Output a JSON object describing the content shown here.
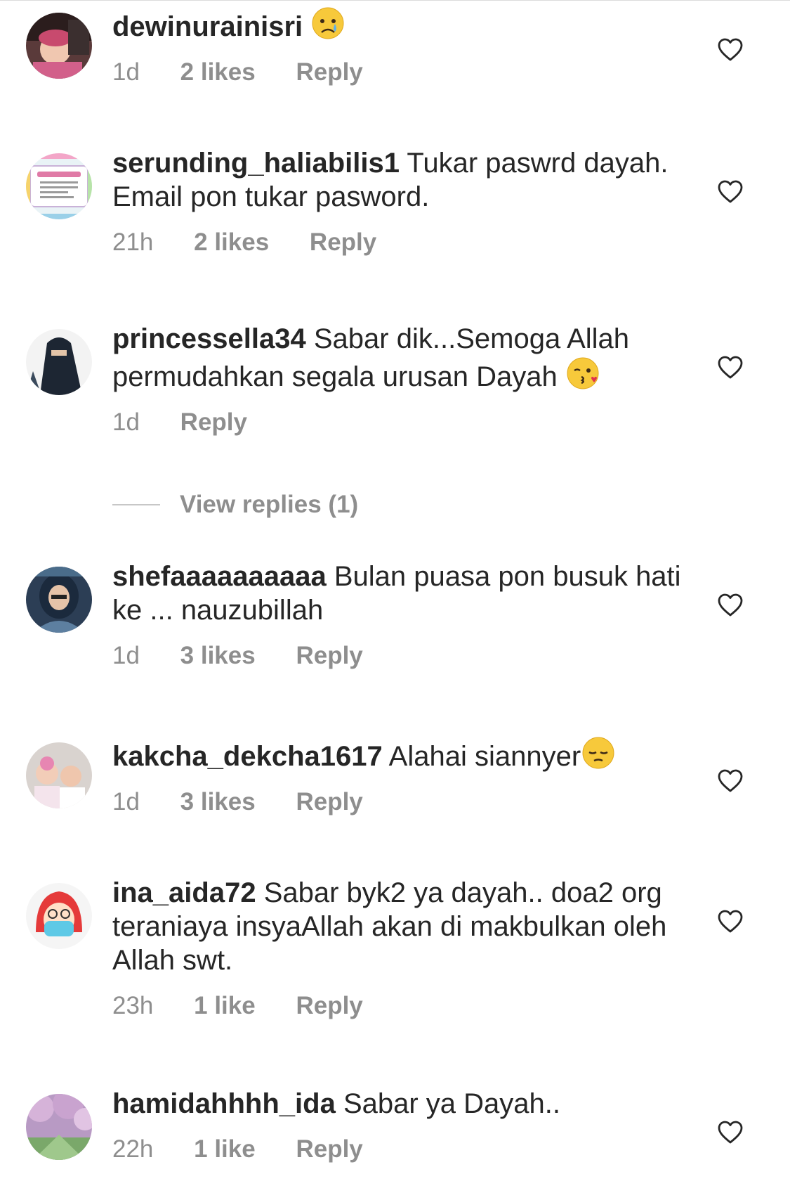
{
  "comments": [
    {
      "username": "dewinurainisri",
      "text": "",
      "emoji": "crying-face",
      "time": "1d",
      "likes": "2 likes",
      "reply": "Reply",
      "avatar": "baby-photo"
    },
    {
      "username": "serunding_haliabilis1",
      "text": "Tukar paswrd dayah. Email pon tukar pasword.",
      "emoji": "",
      "time": "21h",
      "likes": "2 likes",
      "reply": "Reply",
      "avatar": "shop-label-photo"
    },
    {
      "username": "princessella34",
      "text": "Sabar dik...Semoga Allah permudahkan segala urusan Dayah",
      "emoji": "face-blowing-kiss",
      "time": "1d",
      "likes": "",
      "reply": "Reply",
      "avatar": "niqab-photo"
    },
    {
      "username": "shefaaaaaaaaaa",
      "text": "Bulan puasa pon busuk hati ke ... nauzubillah",
      "emoji": "",
      "time": "1d",
      "likes": "3 likes",
      "reply": "Reply",
      "avatar": "hijab-selfie-photo"
    },
    {
      "username": "kakcha_dekcha1617",
      "text": "Alahai siannyer",
      "emoji": "pensive-face",
      "time": "1d",
      "likes": "3 likes",
      "reply": "Reply",
      "avatar": "two-babies-photo"
    },
    {
      "username": "ina_aida72",
      "text": "Sabar byk2 ya dayah.. doa2 org teraniaya insyaAllah akan di makbulkan oleh Allah swt.",
      "emoji": "",
      "time": "23h",
      "likes": "1 like",
      "reply": "Reply",
      "avatar": "masked-avatar"
    },
    {
      "username": "hamidahhhh_ida",
      "text": "Sabar ya Dayah..",
      "emoji": "",
      "time": "22h",
      "likes": "1 like",
      "reply": "Reply",
      "avatar": "blossom-photo"
    }
  ],
  "view_replies": {
    "label": "View replies (1)"
  },
  "icons": {
    "like": "heart-outline-icon"
  },
  "colors": {
    "text_primary": "#262626",
    "text_secondary": "#8e8e8e"
  }
}
